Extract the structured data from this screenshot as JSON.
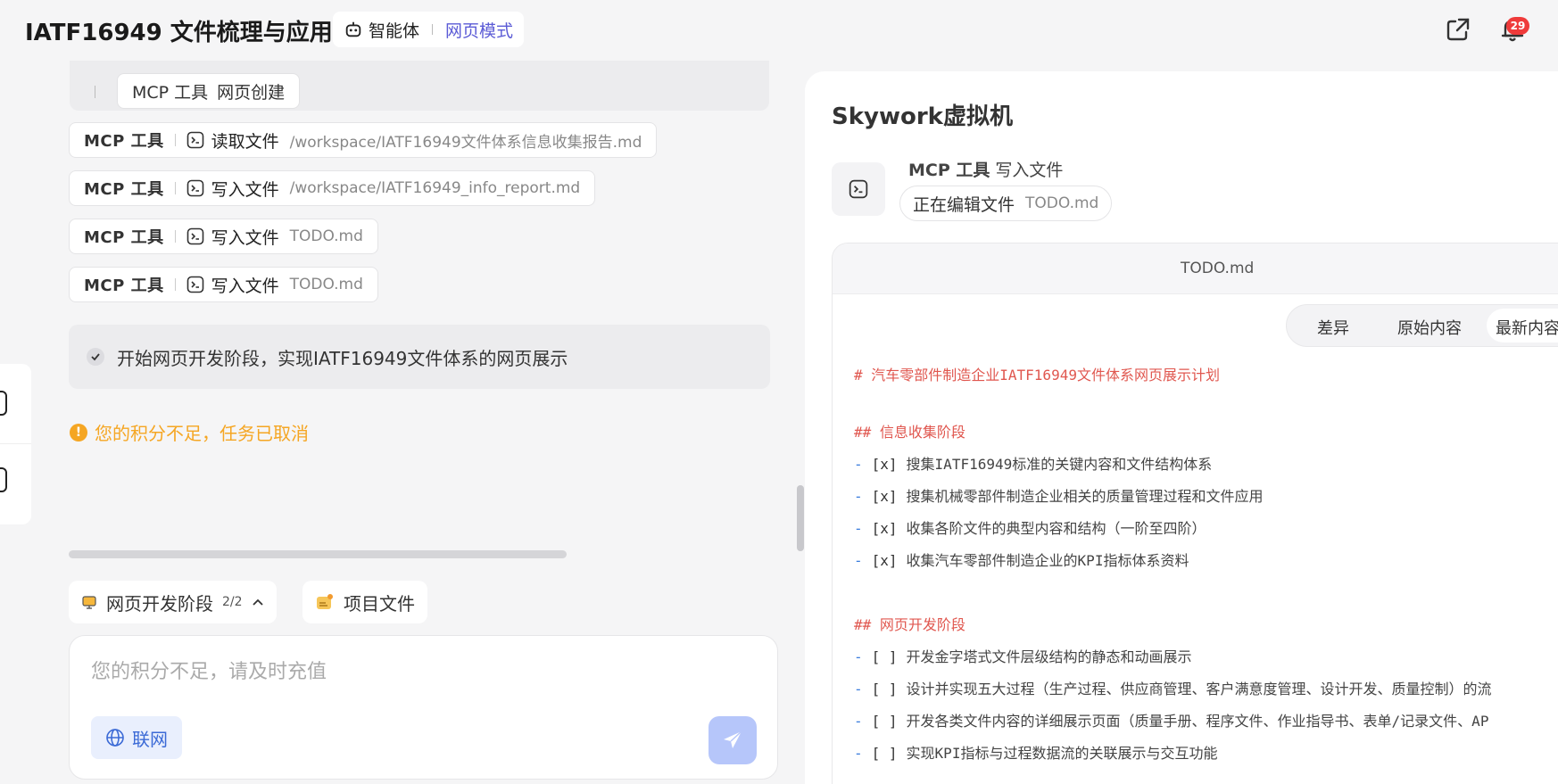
{
  "header": {
    "title": "IATF16949 文件梳理与应用",
    "mode_agent": "智能体",
    "mode_web": "网页模式",
    "notification_count": "29"
  },
  "chat": {
    "collapsed_tool": {
      "mcp": "MCP 工具",
      "action": "网页创建"
    },
    "tool_calls": [
      {
        "mcp": "MCP 工具",
        "action": "读取文件",
        "path": "/workspace/IATF16949文件体系信息收集报告.md"
      },
      {
        "mcp": "MCP 工具",
        "action": "写入文件",
        "path": "/workspace/IATF16949_info_report.md"
      },
      {
        "mcp": "MCP 工具",
        "action": "写入文件",
        "path": "TODO.md"
      },
      {
        "mcp": "MCP 工具",
        "action": "写入文件",
        "path": "TODO.md"
      }
    ],
    "step_text": "开始网页开发阶段，实现IATF16949文件体系的网页展示",
    "warning_icon": "!",
    "warning": "您的积分不足，任务已取消",
    "phase_chip": {
      "label": "网页开发阶段",
      "count": "2/2"
    },
    "files_chip": {
      "label": "项目文件"
    },
    "input_placeholder": "您的积分不足，请及时充值",
    "network_label": "联网"
  },
  "vm": {
    "title": "Skywork虚拟机",
    "tool_mcp": "MCP 工具",
    "tool_action": "写入文件",
    "editing_label": "正在编辑文件",
    "editing_file": "TODO.md",
    "editor_filename": "TODO.md",
    "tabs": [
      "差异",
      "原始内容",
      "最新内容"
    ],
    "lines": {
      "l0": "# 汽车零部件制造企业IATF16949文件体系网页展示计划",
      "l1": "## 信息收集阶段",
      "l2": "搜集IATF16949标准的关键内容和文件结构体系",
      "l3": "搜集机械零部件制造企业相关的质量管理过程和文件应用",
      "l4": "收集各阶文件的典型内容和结构（一阶至四阶）",
      "l5": "收集汽车零部件制造企业的KPI指标体系资料",
      "l6": "## 网页开发阶段",
      "l7": "开发金字塔式文件层级结构的静态和动画展示",
      "l8": "设计并实现五大过程（生产过程、供应商管理、客户满意度管理、设计开发、质量控制）的流",
      "l9": "开发各类文件内容的详细展示页面（质量手册、程序文件、作业指导书、表单/记录文件、AP",
      "l10": "实现KPI指标与过程数据流的关联展示与交互功能"
    },
    "list_marker": "-",
    "checked_box": "[x]",
    "empty_box": "[ ]"
  }
}
